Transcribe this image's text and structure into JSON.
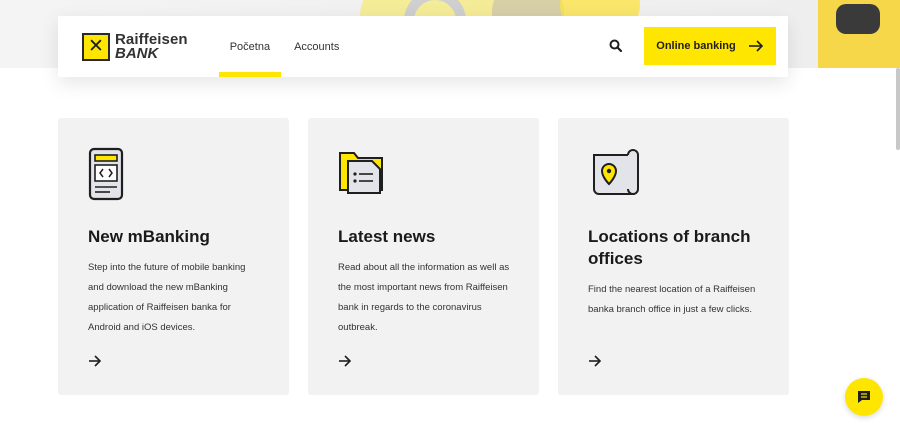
{
  "brand": {
    "logo_line1": "Raiffeisen",
    "logo_line2": "BANK",
    "mark_glyph": "✕",
    "accent": "#fee600"
  },
  "nav": {
    "items": [
      {
        "label": "Početna",
        "active": true
      },
      {
        "label": "Accounts",
        "active": false
      }
    ]
  },
  "header": {
    "search_icon": "search-icon",
    "online_banking_label": "Online banking"
  },
  "cards": [
    {
      "icon": "mobile-phone-icon",
      "title": "New mBanking",
      "text": "Step into the future of mobile banking and download the new mBanking application of Raiffeisen banka for Android and iOS devices.",
      "arrow_icon": "arrow-right-icon"
    },
    {
      "icon": "news-folder-icon",
      "title": "Latest news",
      "text": "Read about all the information as well as the most important news from Raiffeisen bank in regards to the coronavirus outbreak.",
      "arrow_icon": "arrow-right-icon"
    },
    {
      "icon": "map-location-icon",
      "title": "Locations of branch offices",
      "text": "Find the nearest location of a Raiffeisen banka branch office in just a few clicks.",
      "arrow_icon": "arrow-right-icon"
    }
  ],
  "chat": {
    "icon": "chat-icon"
  }
}
